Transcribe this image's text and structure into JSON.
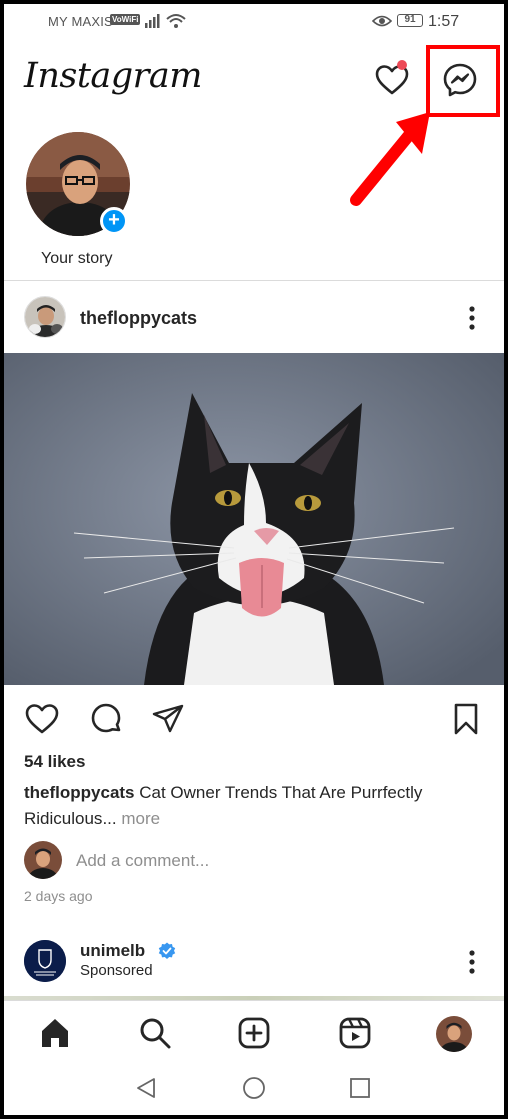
{
  "status_bar": {
    "carrier": "MY MAXIS",
    "vowifi": "VoWiFi",
    "battery": "91",
    "time": "1:57"
  },
  "header": {
    "logo": "Instagram",
    "activity_icon": "heart-icon",
    "messenger_icon": "messenger-icon"
  },
  "stories": [
    {
      "label": "Your story"
    }
  ],
  "post": {
    "username": "thefloppycats",
    "likes": "54 likes",
    "caption_user": "thefloppycats",
    "caption_text": " Cat Owner Trends That Are Purrfectly Ridiculous",
    "caption_ellipsis": "...",
    "caption_more": " more",
    "comment_placeholder": "Add a comment...",
    "time_ago": "2 days ago"
  },
  "sponsored_post": {
    "username": "unimelb",
    "label": "Sponsored"
  },
  "bottom_nav": [
    "home-icon",
    "search-icon",
    "new-post-icon",
    "reels-icon",
    "profile-avatar"
  ],
  "colors": {
    "accent": "#0095f6",
    "notification": "#ed4956",
    "annotation": "#ff0000"
  }
}
